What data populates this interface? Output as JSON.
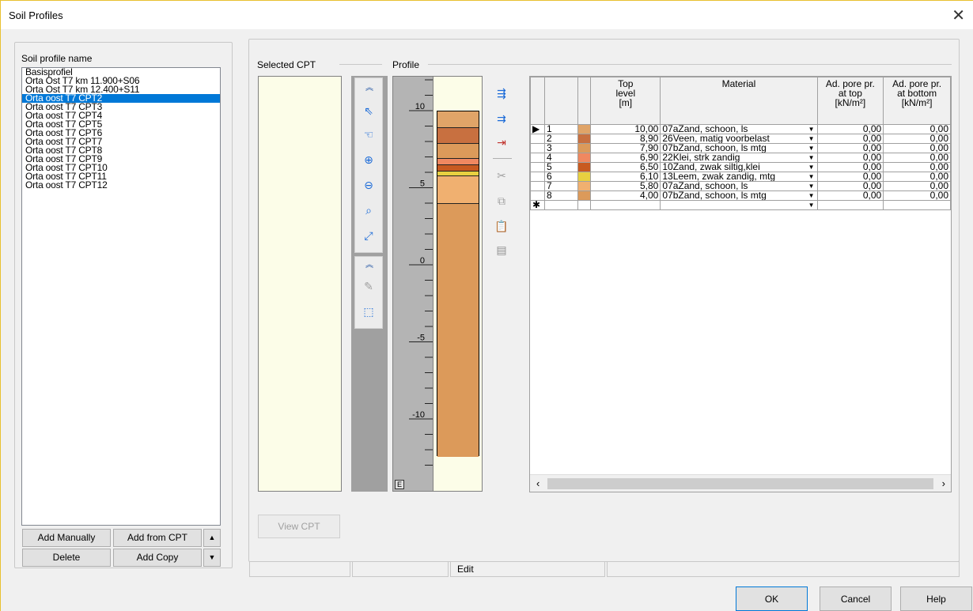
{
  "window": {
    "title": "Soil Profiles"
  },
  "left": {
    "list_label": "Soil profile name",
    "items": [
      "Basisprofiel",
      "Orta Ost T7 km 11.900+S06",
      "Orta Ost T7 km 12.400+S11",
      "Orta oost T7 CPT2",
      "Orta oost T7 CPT3",
      "Orta oost T7 CPT4",
      "Orta oost T7 CPT5",
      "Orta oost T7 CPT6",
      "Orta oost T7 CPT7",
      "Orta oost T7 CPT8",
      "Orta oost T7 CPT9",
      "Orta oost T7 CPT10",
      "Orta oost T7 CPT11",
      "Orta oost T7 CPT12"
    ],
    "selected_index": 3,
    "buttons": {
      "add_manually": "Add Manually",
      "add_from_cpt": "Add from CPT",
      "delete": "Delete",
      "add_copy": "Add Copy"
    }
  },
  "right": {
    "selected_cpt_label": "Selected CPT",
    "profile_label": "Profile",
    "view_cpt_label": "View CPT",
    "ruler": {
      "ticks": [
        "10",
        "5",
        "0",
        "-5",
        "-10"
      ],
      "corner": "E"
    },
    "grid": {
      "headers": [
        "Top\nlevel\n[m]",
        "Material",
        "Ad. pore pr.\nat top\n[kN/m²]",
        "Ad. pore pr.\nat bottom\n[kN/m²]"
      ],
      "rows": [
        {
          "n": "1",
          "color": "#e0a468",
          "top": "10,00",
          "material": "07aZand, schoon, ls",
          "ptop": "0,00",
          "pbot": "0,00"
        },
        {
          "n": "2",
          "color": "#c87040",
          "top": "8,90",
          "material": "26Veen, matig voorbelast",
          "ptop": "0,00",
          "pbot": "0,00"
        },
        {
          "n": "3",
          "color": "#dc9a5a",
          "top": "7,90",
          "material": "07bZand, schoon, ls mtg",
          "ptop": "0,00",
          "pbot": "0,00"
        },
        {
          "n": "4",
          "color": "#f08860",
          "top": "6,90",
          "material": "22Klei, strk zandig",
          "ptop": "0,00",
          "pbot": "0,00"
        },
        {
          "n": "5",
          "color": "#c85a20",
          "top": "6,50",
          "material": "10Zand, zwak siltig,klei",
          "ptop": "0,00",
          "pbot": "0,00"
        },
        {
          "n": "6",
          "color": "#e8d040",
          "top": "6,10",
          "material": "13Leem, zwak zandig, mtg",
          "ptop": "0,00",
          "pbot": "0,00"
        },
        {
          "n": "7",
          "color": "#f0b070",
          "top": "5,80",
          "material": "07aZand, schoon, ls",
          "ptop": "0,00",
          "pbot": "0,00"
        },
        {
          "n": "8",
          "color": "#dc9a5a",
          "top": "4,00",
          "material": "07bZand, schoon, ls mtg",
          "ptop": "0,00",
          "pbot": "0,00"
        }
      ],
      "new_row_marker": "✱",
      "current_row_marker": "▶"
    },
    "status": {
      "mode": "Edit"
    }
  },
  "footer": {
    "ok": "OK",
    "cancel": "Cancel",
    "help": "Help"
  },
  "colors": {
    "selection": "#0078d7",
    "cpt_background": "#fcfde8",
    "layer_default": "#dc9a5a"
  }
}
